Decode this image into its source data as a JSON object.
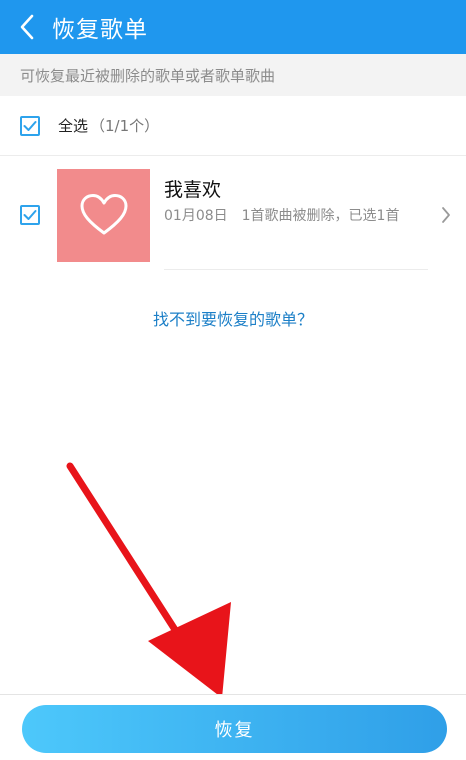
{
  "header": {
    "title": "恢复歌单",
    "back_icon": "chevron-left-icon"
  },
  "hint": {
    "text": "可恢复最近被删除的歌单或者歌单歌曲"
  },
  "select_all": {
    "label": "全选",
    "count": "（1/1个）",
    "checked": true
  },
  "playlists": [
    {
      "name": "我喜欢",
      "date": "01月08日",
      "status": "1首歌曲被删除，已选1首",
      "cover_icon": "heart-icon",
      "cover_color": "#f28b8c",
      "checked": true
    }
  ],
  "links": {
    "cant_find": "找不到要恢复的歌单？"
  },
  "bottom": {
    "restore_label": "恢复"
  },
  "colors": {
    "header": "#1f97ee",
    "accent": "#2ea3ec",
    "link": "#1c7fc7",
    "annotation_arrow": "#e8141a"
  }
}
